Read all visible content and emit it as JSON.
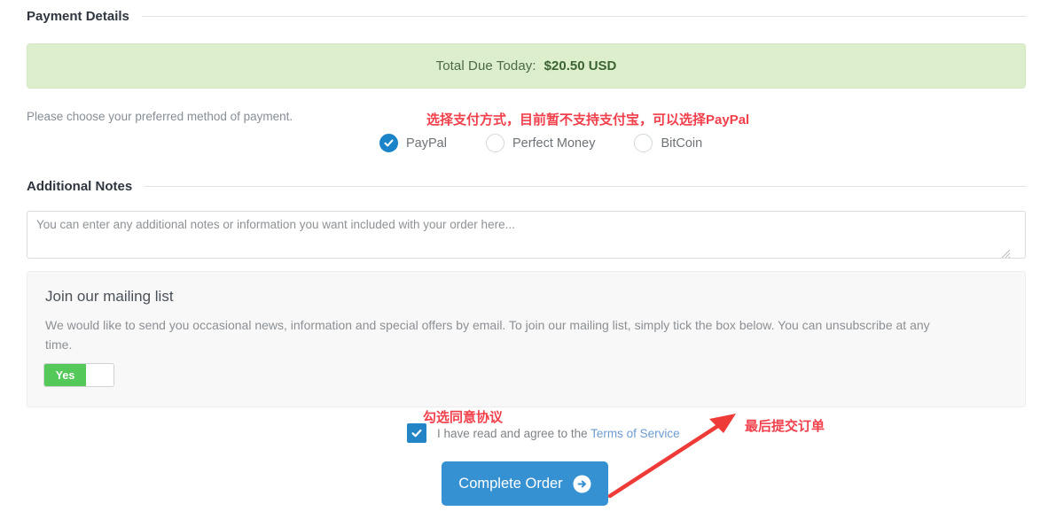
{
  "sections": {
    "payment": {
      "title": "Payment Details"
    },
    "notes": {
      "title": "Additional Notes"
    }
  },
  "total": {
    "label": "Total Due Today:",
    "amount": "$20.50 USD"
  },
  "payment_methods": {
    "prompt": "Please choose your preferred method of payment.",
    "options": [
      {
        "label": "PayPal",
        "selected": true
      },
      {
        "label": "Perfect Money",
        "selected": false
      },
      {
        "label": "BitCoin",
        "selected": false
      }
    ]
  },
  "notes_field": {
    "placeholder": "You can enter any additional notes or information you want included with your order here...",
    "value": ""
  },
  "mailing_list": {
    "title": "Join our mailing list",
    "body": "We would like to send you occasional news, information and special offers by email. To join our mailing list, simply tick the box below. You can unsubscribe at any time.",
    "toggle_label": "Yes",
    "toggle_state": "on"
  },
  "terms": {
    "text_before": "I have read and agree to the",
    "link_label": "Terms of Service",
    "checked": true
  },
  "submit": {
    "label": "Complete Order",
    "icon": "arrow-right-circle-icon"
  },
  "annotations": [
    {
      "id": "payment",
      "text": "选择支付方式，目前暂不支持支付宝，可以选择PayPal"
    },
    {
      "id": "agree",
      "text": "勾选同意协议"
    },
    {
      "id": "submit",
      "text": "最后提交订单"
    }
  ],
  "colors": {
    "alert_bg": "#ddeecd",
    "alert_text": "#3c6332",
    "accent_blue": "#3591d1",
    "toggle_green": "#55c85a",
    "annotation_red": "#f1404b",
    "link_blue": "#6c9bd1"
  }
}
